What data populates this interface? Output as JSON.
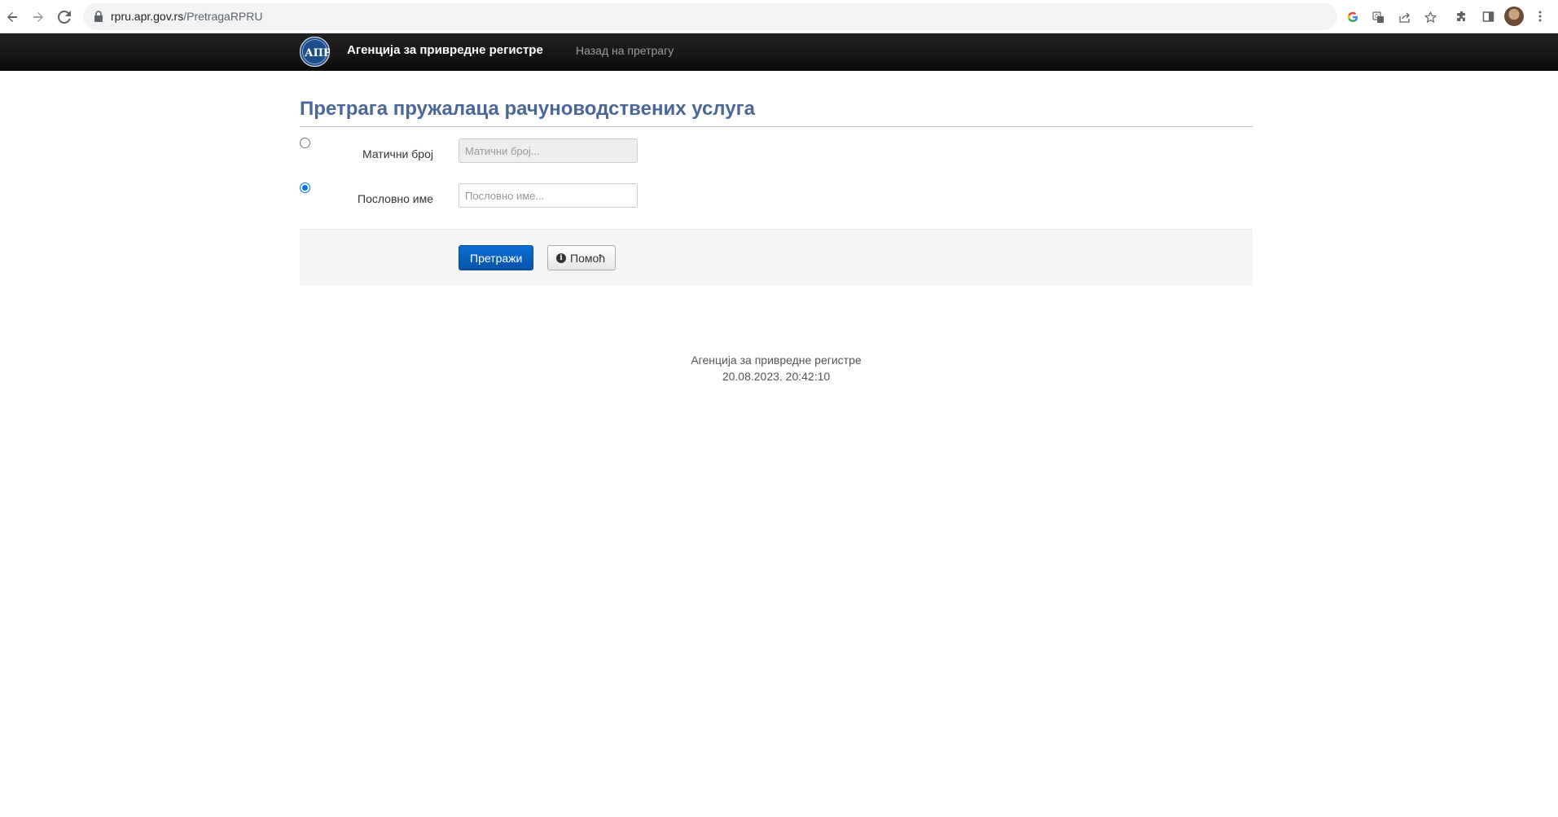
{
  "browser": {
    "url_host": "rpru.apr.gov.rs",
    "url_path": "/PretragaRPRU"
  },
  "navbar": {
    "brand": "Агенција за привредне регистре",
    "back_link": "Назад на претрагу",
    "logo_text": "АПР"
  },
  "main": {
    "title": "Претрага пружалаца рачуноводствених услуга",
    "fields": [
      {
        "label": "Матични број",
        "placeholder": "Матични број...",
        "value": "",
        "selected": false,
        "disabled": true
      },
      {
        "label": "Пословно име",
        "placeholder": "Пословно име...",
        "value": "",
        "selected": true,
        "disabled": false
      }
    ],
    "search_button": "Претражи",
    "help_button": "Помоћ"
  },
  "footer": {
    "agency": "Агенција за привредне регистре",
    "timestamp": "20.08.2023. 20:42:10"
  },
  "colors": {
    "title": "#4a6799",
    "primary_button": "#0a6fd6",
    "navbar": "#1a1a1a"
  }
}
